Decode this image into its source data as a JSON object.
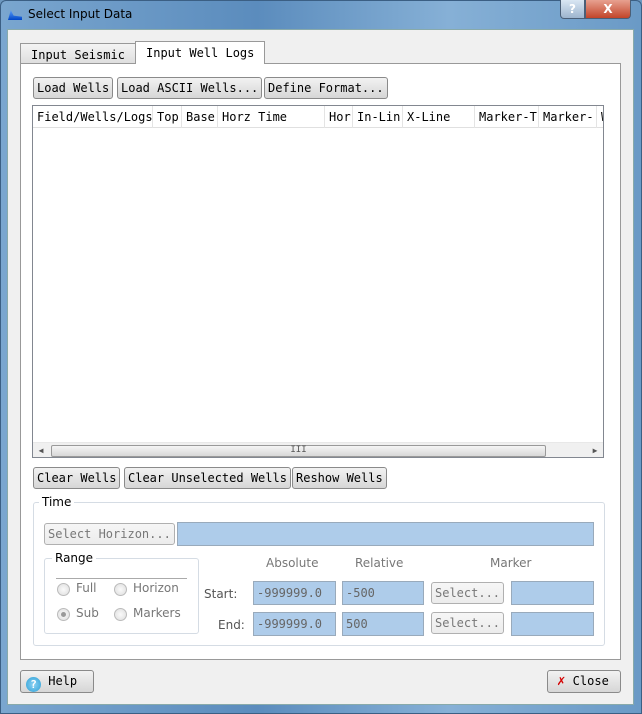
{
  "window": {
    "title": "Select Input Data",
    "help_caption": "?",
    "close_caption": "X"
  },
  "tabs": [
    {
      "label": "Input Seismic"
    },
    {
      "label": "Input Well Logs",
      "active": true
    }
  ],
  "toolbar": {
    "load_wells": "Load Wells",
    "load_ascii": "Load ASCII Wells...",
    "define_format": "Define Format..."
  },
  "table": {
    "columns": [
      "Field/Wells/Logs",
      "Top",
      "Base",
      "Horz Time",
      "Hor",
      "In-Lin",
      "X-Line",
      "Marker-T",
      "Marker-",
      "W"
    ],
    "rows": [],
    "scroll_grip": "III"
  },
  "actions": {
    "clear_wells": "Clear Wells",
    "clear_unselected": "Clear Unselected Wells",
    "reshow": "Reshow Wells"
  },
  "time": {
    "title": "Time",
    "select_horizon": "Select Horizon...",
    "horizon_value": "",
    "range": {
      "title": "Range",
      "options": [
        {
          "label": "Full",
          "selected": false
        },
        {
          "label": "Horizon",
          "selected": false
        },
        {
          "label": "Sub",
          "selected": true
        },
        {
          "label": "Markers",
          "selected": false
        }
      ]
    },
    "headers": {
      "absolute": "Absolute",
      "relative": "Relative",
      "marker": "Marker"
    },
    "start": {
      "label": "Start:",
      "absolute": "-999999.0",
      "relative": "-500",
      "select": "Select...",
      "marker": ""
    },
    "end": {
      "label": "End:",
      "absolute": "-999999.0",
      "relative": "500",
      "select": "Select...",
      "marker": ""
    }
  },
  "footer": {
    "help": "Help",
    "close": "Close"
  },
  "colors": {
    "field_bg": "#aeccea",
    "close_icon": "#d40000",
    "help_icon": "#2a9fd6"
  }
}
